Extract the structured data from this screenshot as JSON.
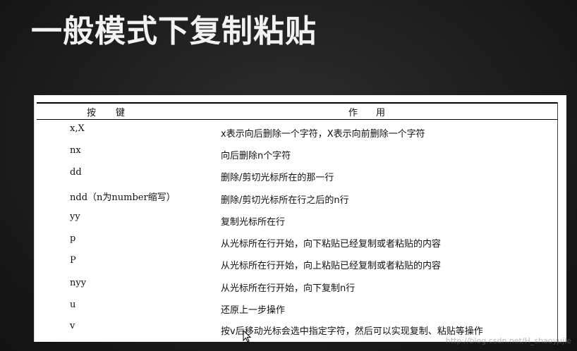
{
  "title": "一般模式下复制粘贴",
  "table": {
    "headers": {
      "key": "按键",
      "function": "作用"
    },
    "rows": [
      {
        "key": "x,X",
        "desc": "x表示向后删除一个字符，X表示向前删除一个字符"
      },
      {
        "key": "nx",
        "desc": "向后删除n个字符"
      },
      {
        "key": "dd",
        "desc": "删除/剪切光标所在的那一行"
      },
      {
        "key": "ndd（n为number缩写）",
        "desc": "删除/剪切光标所在行之后的n行"
      },
      {
        "key": "yy",
        "desc": "复制光标所在行"
      },
      {
        "key": "p",
        "desc": "从光标所在行开始，向下粘贴已经复制或者粘贴的内容"
      },
      {
        "key": "P",
        "desc": "从光标所在行开始，向上粘贴已经复制或者粘贴的内容"
      },
      {
        "key": "nyy",
        "desc": "从光标所在行开始，向下复制n行"
      },
      {
        "key": "u",
        "desc": "还原上一步操作"
      },
      {
        "key": "v",
        "desc": "按v后移动光标会选中指定字符，然后可以实现复制、粘贴等操作"
      }
    ]
  },
  "watermark": "http://blog.csdn.net/H_shaoyujie",
  "icons": {
    "cursor": "mouse-pointer-icon"
  }
}
